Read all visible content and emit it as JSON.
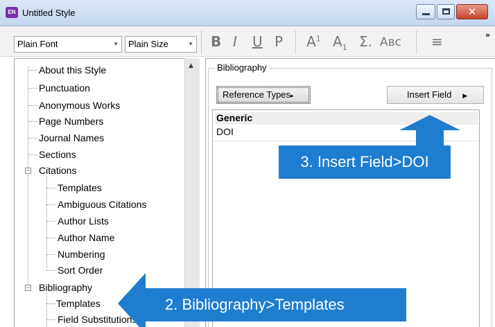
{
  "window": {
    "app_icon_text": "EN",
    "title": "Untitled Style",
    "close_glyph": "✕"
  },
  "toolbar": {
    "font_value": "Plain Font",
    "size_value": "Plain Size",
    "bold": "B",
    "italic": "I",
    "underline": "U",
    "plain": "P",
    "superscript_base": "A",
    "superscript_mark": "1",
    "subscript_base": "A",
    "subscript_mark": "1",
    "symbol": "Σ.",
    "smallcaps": "Aʙᴄ",
    "align_icon": "≡",
    "overflow": "»"
  },
  "tree": {
    "items": [
      {
        "label": "About this Style"
      },
      {
        "label": "Punctuation"
      },
      {
        "label": "Anonymous Works"
      },
      {
        "label": "Page Numbers"
      },
      {
        "label": "Journal Names"
      },
      {
        "label": "Sections"
      },
      {
        "label": "Citations"
      },
      {
        "label": "Templates"
      },
      {
        "label": "Ambiguous Citations"
      },
      {
        "label": "Author Lists"
      },
      {
        "label": "Author Name"
      },
      {
        "label": "Numbering"
      },
      {
        "label": "Sort Order"
      },
      {
        "label": "Bibliography"
      },
      {
        "label": "Templates"
      },
      {
        "label": "Field Substitutions"
      }
    ],
    "selected_index": 14
  },
  "bibliography_panel": {
    "group_label": "Bibliography",
    "reference_types_button": "Reference Types",
    "insert_field_button": "Insert Field",
    "editor_header": "Generic",
    "editor_line": "DOI"
  },
  "callouts": {
    "step3": "3. Insert Field>DOI",
    "step2": "2. Bibliography>Templates"
  },
  "colors": {
    "callout_blue": "#1f7dd0",
    "selection_gray": "#d0d0d0",
    "titlebar_blue": "#c4d6ee"
  }
}
